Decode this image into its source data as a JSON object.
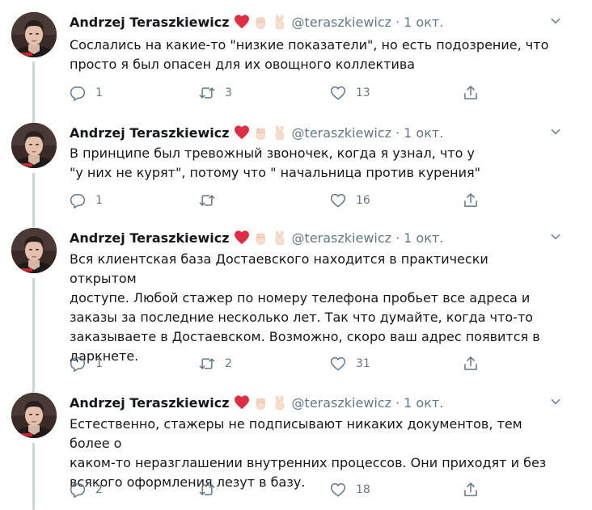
{
  "tweets": [
    {
      "name": "Andrzej Teraszkiewicz",
      "handle": "@teraszkiewicz",
      "separator": "·",
      "date": "1 окт.",
      "text": "Сослались на какие-то \"низкие показатели\", но есть подозрение, что\nпросто я был опасен для их овощного коллектива",
      "replies": "1",
      "retweets": "3",
      "likes": "13"
    },
    {
      "name": "Andrzej Teraszkiewicz",
      "handle": "@teraszkiewicz",
      "separator": "·",
      "date": "1 окт.",
      "text": "В принципе был тревожный звоночек, когда я узнал, что у\n\"у них не курят\", потому что \" начальница против курения\"",
      "replies": "1",
      "retweets": "",
      "likes": "16"
    },
    {
      "name": "Andrzej Teraszkiewicz",
      "handle": "@teraszkiewicz",
      "separator": "·",
      "date": "1 окт.",
      "text": "Вся клиентская база Достаевского находится в практически открытом\nдоступе. Любой стажер по номеру телефона пробьет все адреса и\nзаказы за последние несколько лет. Так что думайте, когда что-то\nзаказываете в Достаевском. Возможно, скоро ваш адрес появится в\nдаркнете.",
      "replies": "1",
      "retweets": "2",
      "likes": "31"
    },
    {
      "name": "Andrzej Teraszkiewicz",
      "handle": "@teraszkiewicz",
      "separator": "·",
      "date": "1 окт.",
      "text": "Естественно, стажеры не подписывают никаких документов, тем более о\nкаком-то неразглашении внутренних процессов. Они приходят и без\nвсякого оформления лезут в базу.",
      "replies": "2",
      "retweets": "",
      "likes": "18"
    }
  ],
  "icons": {
    "name_emoji": [
      "red-heart-icon",
      "raised-fist-icon",
      "victory-hand-icon"
    ],
    "caret": "chevron-down-icon",
    "reply": "reply-icon",
    "retweet": "retweet-icon",
    "like": "heart-outline-icon",
    "share": "share-icon"
  },
  "colors": {
    "text": "#14171a",
    "secondary": "#657786",
    "thread_line": "#ccd6dd",
    "heart": "#dd2e44",
    "skin": "#f7dece"
  }
}
